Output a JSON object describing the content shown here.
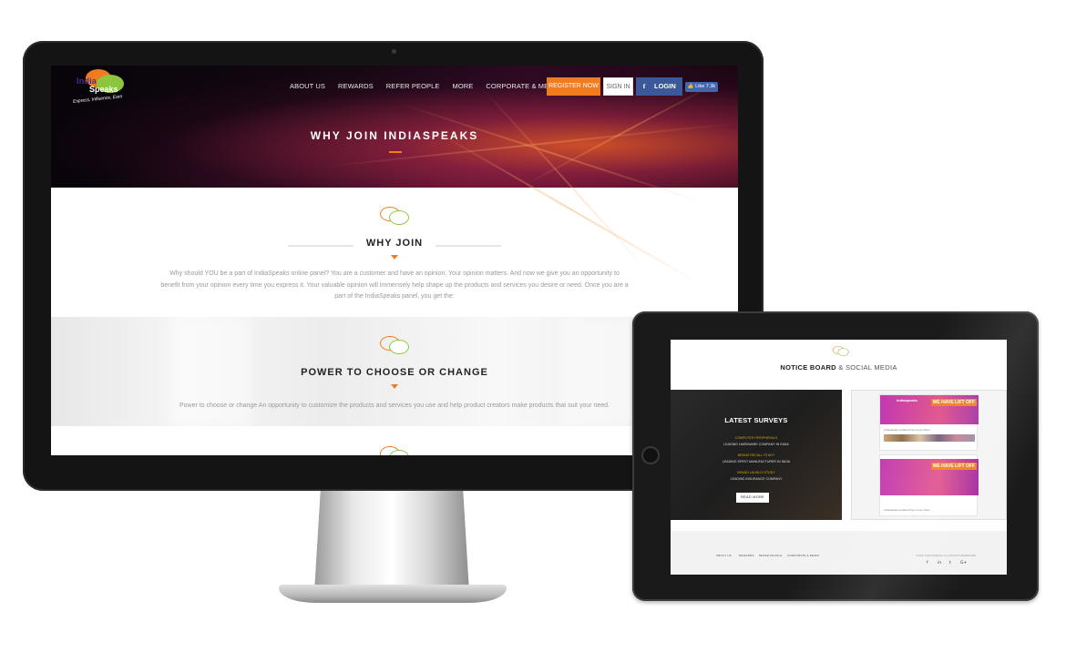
{
  "desktop": {
    "logo": {
      "line1": "India",
      "line2": "Speaks",
      "tagline": "Express, Influence, Earn"
    },
    "nav": {
      "items": [
        "ABOUT US",
        "REWARDS",
        "REFER PEOPLE",
        "MORE",
        "CORPORATE & MEDIA"
      ],
      "register": "REGISTER NOW",
      "signin": "SIGN IN",
      "login": "LOGIN",
      "facebook_glyph": "f",
      "like": "👍 Like 7.3k"
    },
    "hero": {
      "title": "WHY JOIN INDIASPEAKS"
    },
    "why_join": {
      "heading": "WHY JOIN",
      "text": "Why should YOU be a part of IndiaSpeaks online panel? You are a customer and have an opinion. Your opinion matters. And now we give you an opportunity to benefit from your opinion every time you express it. Your valuable opinion will immensely help shape up the products and services you desire or need. Once you are a part of the IndiaSpeaks panel, you get the:"
    },
    "power": {
      "heading": "POWER TO CHOOSE OR CHANGE",
      "text": "Power to choose or change An opportunity to customize the products and services you use and help product creators make products that suit your need."
    }
  },
  "tablet": {
    "heading_bold": "NOTICE BOARD",
    "heading_light": "& SOCIAL MEDIA",
    "surveys": {
      "title": "LATEST SURVEYS",
      "items": [
        {
          "category": "COMPUTER PERIPHERALS",
          "desc": "LEADING HARDWARE COMPANY IN INDIA"
        },
        {
          "category": "BRAND RECALL STUDY",
          "desc": "LEADING SPIRIT MANUFACTURER IN INDIA"
        },
        {
          "category": "BRAND LAUNCH STUDY",
          "desc": "LEADING INSURANCE COMPANY"
        }
      ],
      "read_more": "READ MORE"
    },
    "social": {
      "page_name": "indiaspeaks",
      "banner": "WE HAVE LIFT OFF",
      "post_text": "indiaspeaks updated their cover photo."
    },
    "footer": {
      "links": [
        "ABOUT US",
        "REWARDS",
        "REFER PEOPLE",
        "CORPORATE & MEDIA"
      ],
      "copyright": "©2016 INDIASPEAKS. ALL RIGHTS RESERVED",
      "social_icons": [
        "f",
        "in",
        "t",
        "G+"
      ]
    }
  },
  "colors": {
    "accent_orange": "#f07c1e",
    "accent_green": "#8cc63e",
    "facebook_blue": "#3b5998"
  }
}
